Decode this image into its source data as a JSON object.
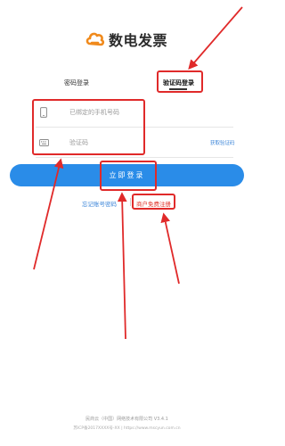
{
  "app": {
    "logo_text": "数电发票"
  },
  "tabs": [
    {
      "label": "密码登录",
      "active": false
    },
    {
      "label": "验证码登录",
      "active": true
    }
  ],
  "form": {
    "phone_placeholder": "已绑定的手机号码",
    "code_placeholder": "验证码",
    "get_code_label": "获取验证码",
    "login_label": "立即登录"
  },
  "links": {
    "forgot_label": "忘记账号密码",
    "register_label": "商户免费注册"
  },
  "footer": {
    "company": "民商云（中国）网络技术有限公司  V3.4.1",
    "icp": "苏ICP备2017XXXX号-XX  |  https://www.mscyun.com.cn"
  },
  "colors": {
    "accent": "#2a8ce8",
    "link": "#3a84d8",
    "register": "#e0352b",
    "annotation": "#e02a2a"
  },
  "icons": {
    "logo": "cloud-logo-icon",
    "phone": "phone-icon",
    "code": "keyboard-icon"
  }
}
